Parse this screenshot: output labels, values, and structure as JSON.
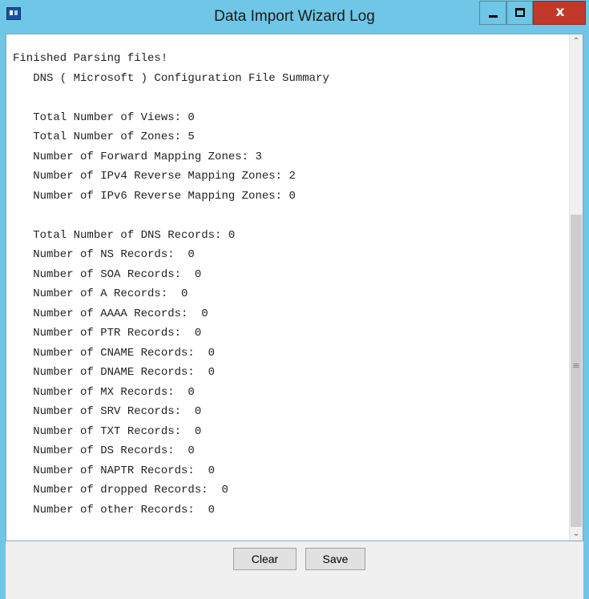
{
  "window": {
    "title": "Data Import Wizard Log",
    "controls": {
      "minimize": "minimize",
      "maximize": "maximize",
      "close": "x"
    }
  },
  "log": {
    "lines": [
      "Finished Parsing files!",
      "   DNS ( Microsoft ) Configuration File Summary",
      "",
      "   Total Number of Views: 0",
      "   Total Number of Zones: 5",
      "   Number of Forward Mapping Zones: 3",
      "   Number of IPv4 Reverse Mapping Zones: 2",
      "   Number of IPv6 Reverse Mapping Zones: 0",
      "",
      "   Total Number of DNS Records: 0",
      "   Number of NS Records:  0",
      "   Number of SOA Records:  0",
      "   Number of A Records:  0",
      "   Number of AAAA Records:  0",
      "   Number of PTR Records:  0",
      "   Number of CNAME Records:  0",
      "   Number of DNAME Records:  0",
      "   Number of MX Records:  0",
      "   Number of SRV Records:  0",
      "   Number of TXT Records:  0",
      "   Number of DS Records:  0",
      "   Number of NAPTR Records:  0",
      "   Number of dropped Records:  0",
      "   Number of other Records:  0"
    ]
  },
  "scrollbar": {
    "up_icon": "chevron-up-icon",
    "down_icon": "chevron-down-icon",
    "grip_icon": "grip-icon"
  },
  "buttons": {
    "clear": "Clear",
    "save": "Save"
  },
  "colors": {
    "titlebar": "#6fc6e6",
    "close": "#c0392b",
    "log_background": "#ffffff",
    "footer": "#f0f0f0"
  }
}
